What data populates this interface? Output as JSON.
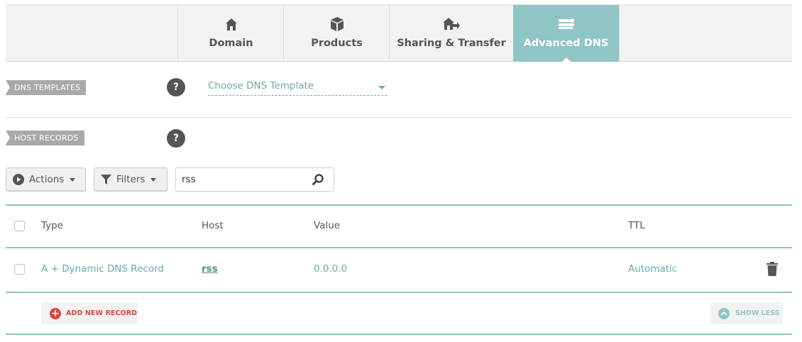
{
  "tabs": [
    {
      "label": "Domain",
      "icon": "home-icon",
      "active": false
    },
    {
      "label": "Products",
      "icon": "box-icon",
      "active": false
    },
    {
      "label": "Sharing & Transfer",
      "icon": "house-transfer-icon",
      "active": false
    },
    {
      "label": "Advanced DNS",
      "icon": "server-stack-icon",
      "active": true
    }
  ],
  "dns_templates": {
    "ribbon": "DNS TEMPLATES",
    "help": "?",
    "select_value": "Choose DNS Template"
  },
  "host_records": {
    "ribbon": "HOST RECORDS",
    "help": "?"
  },
  "toolbar": {
    "actions_label": "Actions",
    "filters_label": "Filters",
    "search_value": "rss"
  },
  "table": {
    "columns": [
      "Type",
      "Host",
      "Value",
      "TTL"
    ],
    "rows": [
      {
        "type": "A + Dynamic DNS Record",
        "host": "rss",
        "value": "0.0.0.0",
        "ttl": "Automatic"
      }
    ]
  },
  "footer": {
    "add_label": "ADD NEW RECORD",
    "show_less_label": "SHOW LESS"
  },
  "colors": {
    "accent": "#8fc5c4",
    "link": "#6aa9a6",
    "danger": "#e0443a",
    "ribbon": "#a9a9a9"
  }
}
